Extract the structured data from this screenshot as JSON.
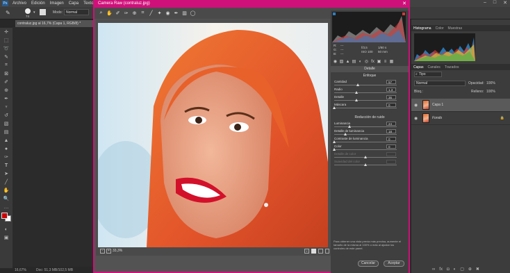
{
  "ps": {
    "logo": "Ps",
    "menu": [
      "Archivo",
      "Edición",
      "Imagen",
      "Capa",
      "Texto"
    ],
    "window_controls": [
      "–",
      "□",
      "✕"
    ],
    "options": {
      "brush_size": "74",
      "mode_label": "Modo:",
      "mode_value": "Normal"
    },
    "doc_tab": "contraluz.jpg al 16,7% (Capa 1, RGB/8) *",
    "status": {
      "zoom": "16,67%",
      "doc": "Doc: 51,3 MB/102,5 MB"
    }
  },
  "camera_raw": {
    "title": "Camera Raw (contraluz.jpg)",
    "close": "✕",
    "toolbar_icons": [
      "zoom-icon",
      "hand-icon",
      "white-balance-icon",
      "color-sampler-icon",
      "targeted-adjust-icon",
      "crop-icon",
      "straighten-icon",
      "spot-removal-icon",
      "red-eye-icon",
      "adjustment-brush-icon",
      "graduated-filter-icon",
      "radial-filter-icon"
    ],
    "zoom_level": "33,3%",
    "readout": {
      "r_label": "R:",
      "g_label": "G:",
      "b_label": "B:",
      "r": "---",
      "g": "---",
      "b": "---",
      "aperture": "f/3,5",
      "shutter": "1/80 s",
      "iso": "ISO 100",
      "focal": "50 mm"
    },
    "panel_title": "Detalle",
    "sharpen_title": "Enfoque",
    "sharpen": [
      {
        "label": "Cantidad",
        "value": "57",
        "pos": 0.38
      },
      {
        "label": "Radio",
        "value": "1,3",
        "pos": 0.35
      },
      {
        "label": "Detalle",
        "value": "36",
        "pos": 0.36
      },
      {
        "label": "Máscara",
        "value": "0",
        "pos": 0.0
      }
    ],
    "noise_title": "Reducción de ruido",
    "noise": [
      {
        "label": "Luminancia",
        "value": "24",
        "pos": 0.24,
        "dim": false
      },
      {
        "label": "Detalle de luminancia",
        "value": "18",
        "pos": 0.18,
        "dim": false
      },
      {
        "label": "Contraste de luminancia",
        "value": "0",
        "pos": 0.0,
        "dim": false
      },
      {
        "label": "Color",
        "value": "0",
        "pos": 0.0,
        "dim": false
      },
      {
        "label": "Detalle de color",
        "value": "",
        "pos": 0.5,
        "dim": true
      },
      {
        "label": "Suavidad del color",
        "value": "",
        "pos": 0.5,
        "dim": true
      }
    ],
    "hint": "Para obtener una vista previa más precisa, aumente el tamaño de la misma al 100% o más al ajustar los controles de este panel.",
    "cancel": "Cancelar",
    "accept": "Aceptar"
  },
  "right_panels": {
    "top_tabs": [
      "Histograma",
      "Color",
      "Muestras"
    ],
    "layer_tabs": [
      "Capas",
      "Canales",
      "Trazados"
    ],
    "search_kind": "Tipo",
    "blend": "Normal",
    "opacity_label": "Opacidad:",
    "opacity": "100%",
    "lock_label": "Bloq.:",
    "fill_label": "Relleno:",
    "fill": "100%",
    "layers": [
      {
        "name": "Capa 1",
        "selected": true,
        "italic": false
      },
      {
        "name": "Fondo",
        "selected": false,
        "italic": true
      }
    ]
  },
  "colors": {
    "accent": "#d0107a",
    "fg_swatch": "#cc0000",
    "bg_swatch": "#ffffff"
  }
}
